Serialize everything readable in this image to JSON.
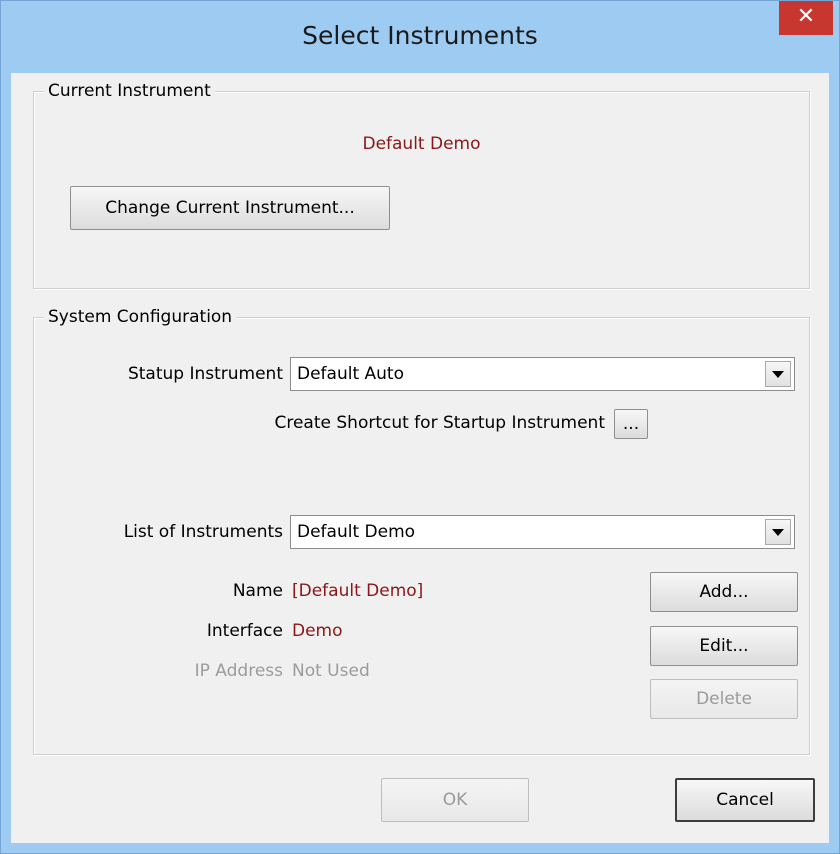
{
  "window": {
    "title": "Select Instruments",
    "close_glyph": "✕"
  },
  "current_instrument": {
    "legend": "Current Instrument",
    "value": "Default Demo",
    "change_button": "Change Current Instrument..."
  },
  "system_configuration": {
    "legend": "System Configuration",
    "startup_label": "Statup Instrument",
    "startup_value": "Default Auto",
    "shortcut_label": "Create Shortcut for Startup Instrument",
    "shortcut_button": "...",
    "list_label": "List of Instruments",
    "list_value": "Default Demo",
    "name_label": "Name",
    "name_value": "[Default Demo]",
    "interface_label": "Interface",
    "interface_value": "Demo",
    "ip_label": "IP Address",
    "ip_value": "Not Used",
    "add_button": "Add...",
    "edit_button": "Edit...",
    "delete_button": "Delete"
  },
  "footer": {
    "ok_button": "OK",
    "cancel_button": "Cancel"
  },
  "colors": {
    "title_bar": "#9ecbf2",
    "close_button": "#c7372f",
    "accent_value_text": "#8a1717",
    "disabled_text": "#9b9b9b"
  }
}
